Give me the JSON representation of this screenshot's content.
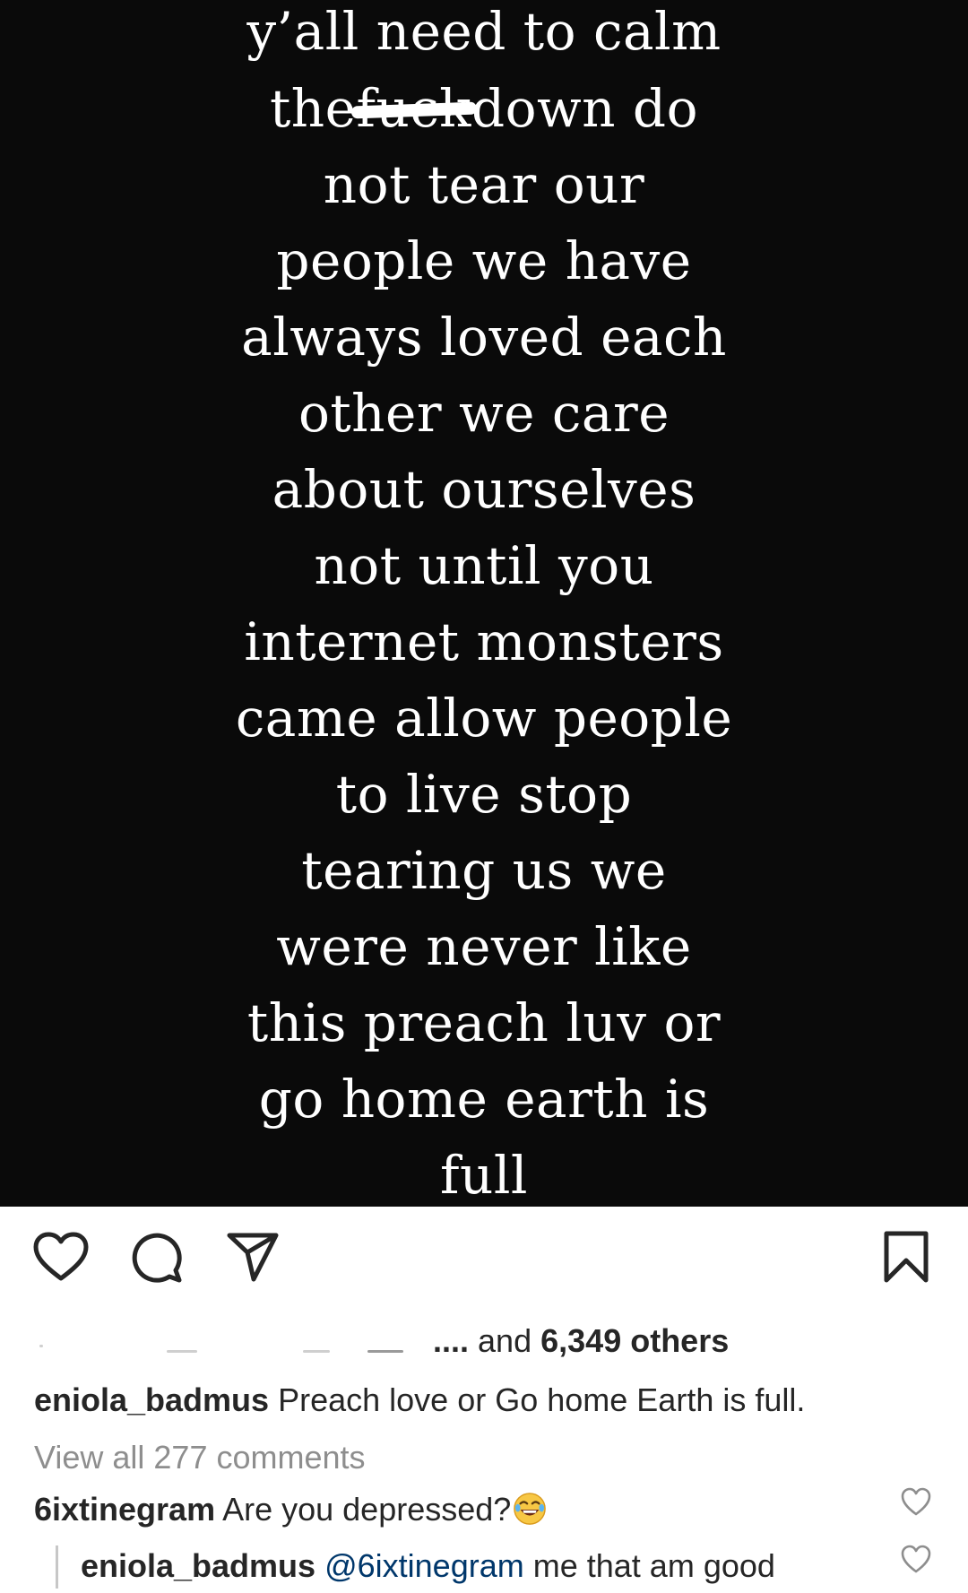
{
  "post": {
    "lines": [
      "y’all need to calm",
      "down do",
      "not tear our",
      "people we have",
      "always loved each",
      "other we care",
      "about ourselves",
      "not until you",
      "internet monsters",
      "came allow people",
      "to live stop",
      "tearing us we",
      "were never like",
      "this preach luv or",
      "go home earth is",
      "full"
    ],
    "line2_prefix": "the",
    "line2_censored": "fuck",
    "background_color": "#0a0a0a",
    "text_color": "#ffffff"
  },
  "actions": {
    "like_icon": "heart-icon",
    "comment_icon": "comment-icon",
    "share_icon": "send-icon",
    "save_icon": "bookmark-icon"
  },
  "likes": {
    "ellipsis": "....",
    "and_text": "and",
    "count_text": "6,349 others"
  },
  "caption": {
    "username": "eniola_badmus",
    "text": "Preach love or Go home Earth is full."
  },
  "view_all_comments": "View all 277 comments",
  "comments": [
    {
      "username": "6ixtinegram",
      "text": "Are you depressed?",
      "emoji": "laughing-emoji"
    },
    {
      "username": "eniola_badmus",
      "mention": "@6ixtinegram",
      "text": "me that am good"
    }
  ],
  "colors": {
    "text_primary": "#262626",
    "text_secondary": "#8e8e8e",
    "mention": "#00376b"
  }
}
